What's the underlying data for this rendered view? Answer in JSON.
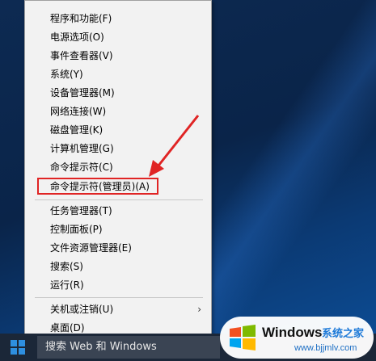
{
  "menu": {
    "items": [
      "程序和功能(F)",
      "电源选项(O)",
      "事件查看器(V)",
      "系统(Y)",
      "设备管理器(M)",
      "网络连接(W)",
      "磁盘管理(K)",
      "计算机管理(G)",
      "命令提示符(C)",
      "命令提示符(管理员)(A)",
      "任务管理器(T)",
      "控制面板(P)",
      "文件资源管理器(E)",
      "搜索(S)",
      "运行(R)",
      "关机或注销(U)",
      "桌面(D)"
    ],
    "submenu_chevron": "›"
  },
  "taskbar": {
    "search_text": "搜索 Web 和 Windows"
  },
  "watermark": {
    "brand": "Windows",
    "sub": "系统之家",
    "url": "www.bjjmlv.com"
  },
  "colors": {
    "highlight": "#e02424",
    "menu_bg": "#f2f2f2",
    "taskbar": "#1b2738"
  },
  "icons": [
    "windows-start-icon",
    "windows-logo-icon",
    "arrow-annotation-icon"
  ]
}
